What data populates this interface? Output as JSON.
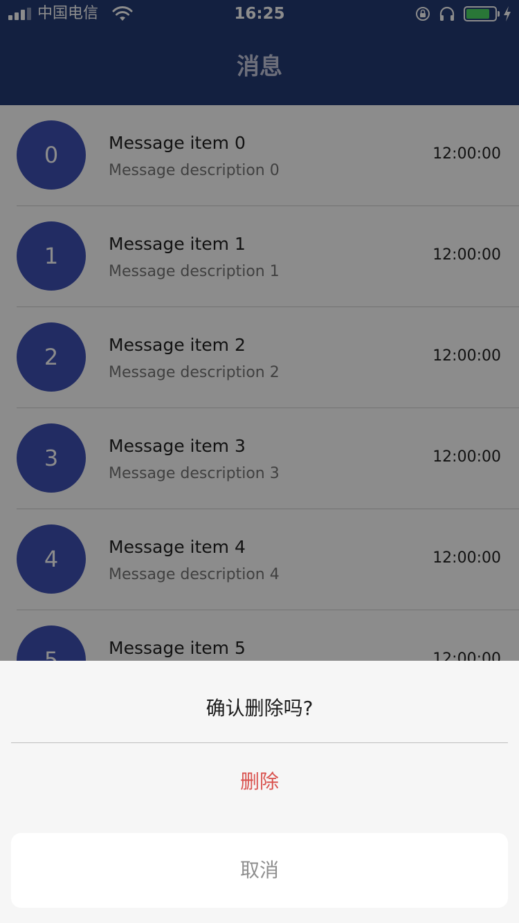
{
  "status_bar": {
    "carrier": "中国电信",
    "time": "16:25",
    "battery_level": 0.84
  },
  "nav": {
    "title": "消息"
  },
  "messages": [
    {
      "avatar": "0",
      "title": "Message item 0",
      "description": "Message description 0",
      "time": "12:00:00"
    },
    {
      "avatar": "1",
      "title": "Message item 1",
      "description": "Message description 1",
      "time": "12:00:00"
    },
    {
      "avatar": "2",
      "title": "Message item 2",
      "description": "Message description 2",
      "time": "12:00:00"
    },
    {
      "avatar": "3",
      "title": "Message item 3",
      "description": "Message description 3",
      "time": "12:00:00"
    },
    {
      "avatar": "4",
      "title": "Message item 4",
      "description": "Message description 4",
      "time": "12:00:00"
    },
    {
      "avatar": "5",
      "title": "Message item 5",
      "description": "",
      "time": "12:00:00"
    }
  ],
  "action_sheet": {
    "title": "确认删除吗?",
    "delete_label": "删除",
    "cancel_label": "取消"
  },
  "colors": {
    "header": "#233b76",
    "avatar": "#3f51b5",
    "destructive": "#d9534f",
    "battery": "#4cd964"
  },
  "icons": [
    "signal-icon",
    "wifi-icon",
    "rotation-lock-icon",
    "headphones-icon",
    "battery-icon",
    "charging-bolt-icon"
  ]
}
